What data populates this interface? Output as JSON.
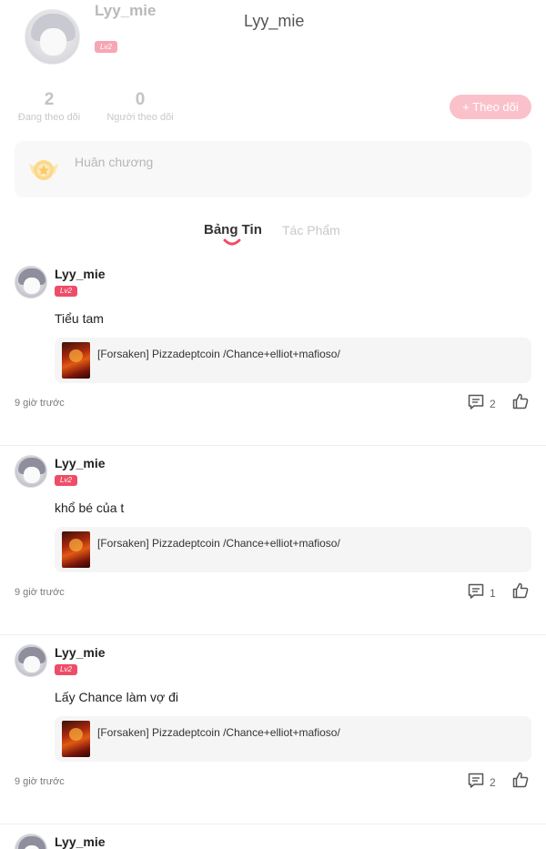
{
  "profile": {
    "name": "Lyy_mie",
    "level": "Lv2",
    "header_title": "Lyy_mie",
    "following_count": "2",
    "following_label": "Đang theo dõi",
    "followers_count": "0",
    "followers_label": "Người theo dõi",
    "follow_button": "+ Theo dõi"
  },
  "medal": {
    "label": "Huân chương"
  },
  "tabs": [
    {
      "label": "Bảng Tin",
      "active": true
    },
    {
      "label": "Tác Phẩm",
      "active": false
    }
  ],
  "posts": [
    {
      "username": "Lyy_mie",
      "level": "Lv2",
      "content": "Tiểu tam",
      "link_title": "[Forsaken] Pizzadeptcoin /Chance+elliot+mafioso/",
      "time": "9 giờ trước",
      "comments": "2"
    },
    {
      "username": "Lyy_mie",
      "level": "Lv2",
      "content": "khổ bé của t",
      "link_title": "[Forsaken] Pizzadeptcoin /Chance+elliot+mafioso/",
      "time": "9 giờ trước",
      "comments": "1"
    },
    {
      "username": "Lyy_mie",
      "level": "Lv2",
      "content": "Lấy Chance làm vợ đi",
      "link_title": "[Forsaken] Pizzadeptcoin /Chance+elliot+mafioso/",
      "time": "9 giờ trước",
      "comments": "2"
    },
    {
      "username": "Lyy_mie"
    }
  ],
  "colors": {
    "accent": "#ee4d68",
    "follow_button_bg": "#fbc1cb",
    "card_bg": "#f5f5f6"
  }
}
